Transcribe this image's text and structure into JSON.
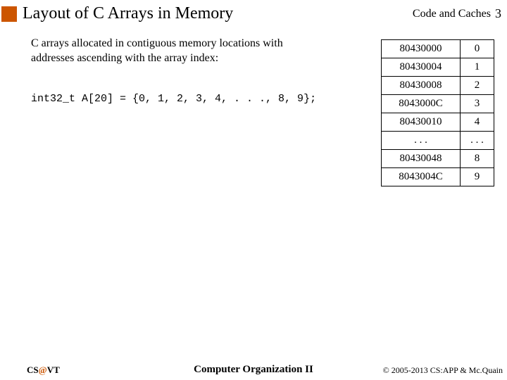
{
  "header": {
    "title": "Layout of C Arrays in Memory",
    "section": "Code and Caches",
    "page": "3"
  },
  "body": {
    "desc": "C arrays allocated in contiguous memory locations with addresses ascending with the array index:",
    "code": "int32_t A[20] = {0, 1, 2, 3, 4, . . ., 8, 9};"
  },
  "table": {
    "rows": [
      {
        "addr": "80430000",
        "val": "0"
      },
      {
        "addr": "80430004",
        "val": "1"
      },
      {
        "addr": "80430008",
        "val": "2"
      },
      {
        "addr": "8043000C",
        "val": "3"
      },
      {
        "addr": "80430010",
        "val": "4"
      },
      {
        "addr": ". . .",
        "val": ". . ."
      },
      {
        "addr": "80430048",
        "val": "8"
      },
      {
        "addr": "8043004C",
        "val": "9"
      }
    ]
  },
  "footer": {
    "left_pre": "CS",
    "left_at": "@",
    "left_post": "VT",
    "center": "Computer Organization II",
    "right": "© 2005-2013 CS:APP & Mc.Quain"
  }
}
